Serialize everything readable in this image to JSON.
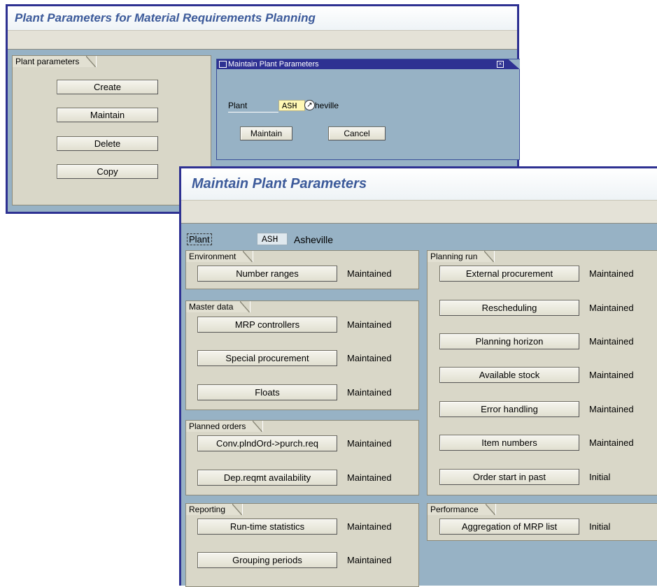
{
  "window1": {
    "title": "Plant Parameters for Material Requirements Planning",
    "group_title": "Plant parameters",
    "buttons": [
      "Create",
      "Maintain",
      "Delete",
      "Copy"
    ]
  },
  "dialog": {
    "title": "Maintain Plant Parameters",
    "plant_label": "Plant",
    "plant_value": "ASH",
    "plant_name_partial": "heville",
    "maintain_button": "Maintain",
    "cancel_button": "Cancel"
  },
  "window2": {
    "title": "Maintain Plant Parameters",
    "plant_label": "Plant",
    "plant_value": "ASH",
    "plant_name": "Asheville",
    "groups": {
      "environment": {
        "title": "Environment",
        "items": [
          {
            "label": "Number ranges",
            "status": "Maintained"
          }
        ]
      },
      "master_data": {
        "title": "Master data",
        "items": [
          {
            "label": "MRP controllers",
            "status": "Maintained"
          },
          {
            "label": "Special procurement",
            "status": "Maintained"
          },
          {
            "label": "Floats",
            "status": "Maintained"
          }
        ]
      },
      "planned_orders": {
        "title": "Planned orders",
        "items": [
          {
            "label": "Conv.plndOrd->purch.req",
            "status": "Maintained"
          },
          {
            "label": "Dep.reqmt availability",
            "status": "Maintained"
          }
        ]
      },
      "reporting": {
        "title": "Reporting",
        "items": [
          {
            "label": "Run-time statistics",
            "status": "Maintained"
          },
          {
            "label": "Grouping periods",
            "status": "Maintained"
          }
        ]
      },
      "planning_run": {
        "title": "Planning run",
        "items": [
          {
            "label": "External procurement",
            "status": "Maintained"
          },
          {
            "label": "Rescheduling",
            "status": "Maintained"
          },
          {
            "label": "Planning horizon",
            "status": "Maintained"
          },
          {
            "label": "Available stock",
            "status": "Maintained"
          },
          {
            "label": "Error handling",
            "status": "Maintained"
          },
          {
            "label": "Item numbers",
            "status": "Maintained"
          },
          {
            "label": "Order start in past",
            "status": "Initial"
          }
        ]
      },
      "performance": {
        "title": "Performance",
        "items": [
          {
            "label": "Aggregation of MRP list",
            "status": "Initial"
          }
        ]
      }
    }
  },
  "colors": {
    "window_border": "#2e3192",
    "title_text": "#3c5a9a",
    "background": "#97b2c5",
    "group_bg": "#d9d7c8",
    "input_highlight": "#fff8b4"
  }
}
